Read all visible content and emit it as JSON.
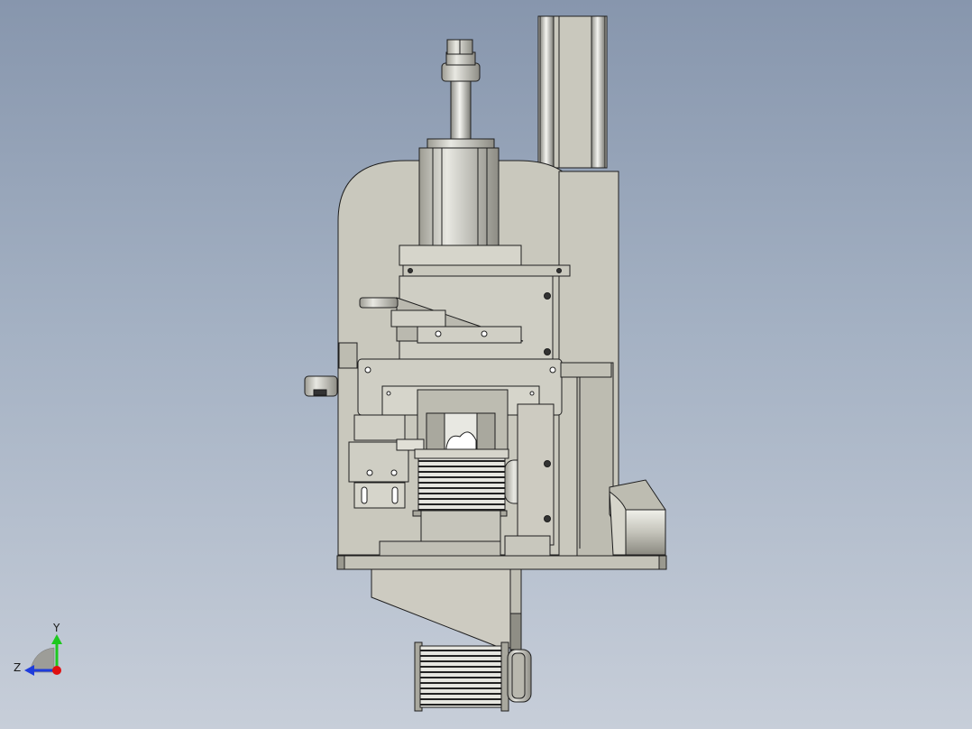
{
  "triad": {
    "y_label": "Y",
    "z_label": "Z",
    "colors": {
      "y": "#1ec81e",
      "z": "#1e3cdc",
      "x": "#e01010"
    }
  },
  "model": {
    "body_color": "#c9c8bd",
    "shadow_color": "#a9a89e",
    "metal_color": "#e2e2dc",
    "edge_color": "#1e1e1e"
  }
}
